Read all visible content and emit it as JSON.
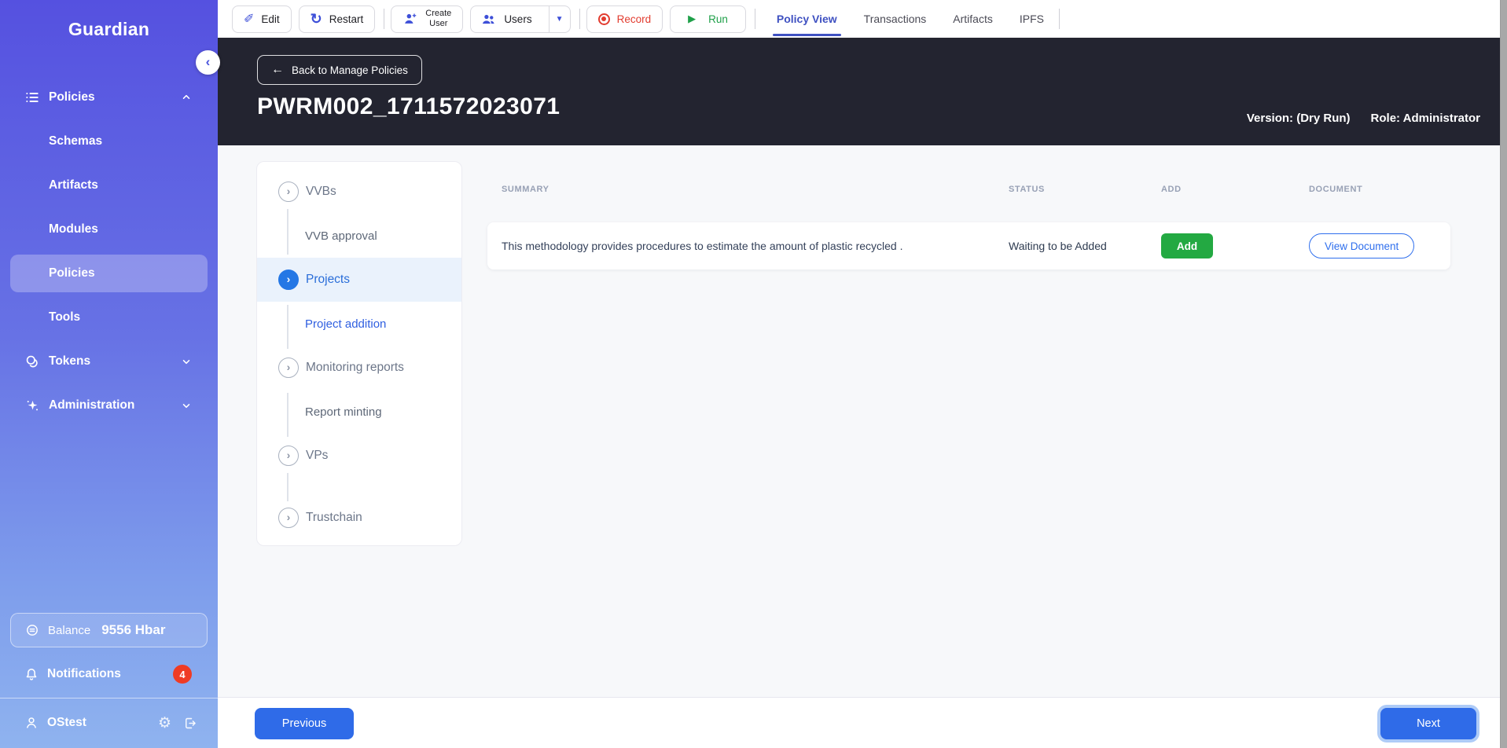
{
  "sidebar": {
    "logo": "Guardian",
    "policies": {
      "label": "Policies"
    },
    "policies_children": [
      {
        "label": "Schemas"
      },
      {
        "label": "Artifacts"
      },
      {
        "label": "Modules"
      },
      {
        "label": "Policies",
        "selected": true
      },
      {
        "label": "Tools"
      }
    ],
    "tokens": {
      "label": "Tokens"
    },
    "administration": {
      "label": "Administration"
    },
    "balance": {
      "label": "Balance",
      "value": "9556 Hbar"
    },
    "notifications": {
      "label": "Notifications",
      "count": "4"
    },
    "user": {
      "name": "OStest"
    }
  },
  "toolbar": {
    "edit_label": "Edit",
    "restart_label": "Restart",
    "create_user_line1": "Create",
    "create_user_line2": "User",
    "users_label": "Users",
    "record_label": "Record",
    "run_label": "Run",
    "tabs": [
      {
        "label": "Policy View",
        "active": true
      },
      {
        "label": "Transactions",
        "active": false
      },
      {
        "label": "Artifacts",
        "active": false
      },
      {
        "label": "IPFS",
        "active": false
      }
    ]
  },
  "header": {
    "back_label": "Back to Manage Policies",
    "title": "PWRM002_1711572023071",
    "version": "Version: (Dry Run)",
    "role": "Role: Administrator"
  },
  "stepper": {
    "items": [
      {
        "label": "VVBs",
        "type": "step",
        "state": "default"
      },
      {
        "label": "VVB approval",
        "type": "substep",
        "state": "default"
      },
      {
        "label": "Projects",
        "type": "step",
        "state": "active"
      },
      {
        "label": "Project addition",
        "type": "substep",
        "state": "active"
      },
      {
        "label": "Monitoring reports",
        "type": "step",
        "state": "default"
      },
      {
        "label": "Report minting",
        "type": "substep",
        "state": "default"
      },
      {
        "label": "VPs",
        "type": "step",
        "state": "default"
      },
      {
        "label": "Trustchain",
        "type": "step",
        "state": "default"
      }
    ]
  },
  "table": {
    "columns": [
      "SUMMARY",
      "STATUS",
      "ADD",
      "DOCUMENT"
    ],
    "rows": [
      {
        "summary": "This methodology provides procedures to estimate the amount of plastic recycled .",
        "status": "Waiting to be Added",
        "add_label": "Add",
        "document_label": "View Document"
      }
    ]
  },
  "footer": {
    "previous_label": "Previous",
    "next_label": "Next"
  },
  "colors": {
    "sidebar_top": "#5551e0",
    "sidebar_bottom": "#8fb3ef",
    "dark_header": "#232430",
    "accent_blue": "#2f6be8",
    "toolbar_icon_blue": "#3d4fd8",
    "active_tab_blue": "#3f51c1",
    "stepper_active_blue": "#2477e5",
    "stepper_active_bg": "#eaf2fc",
    "add_green": "#23a942",
    "record_red": "#e23c2f",
    "badge_red": "#ef3b24",
    "content_bg": "#f7f8fa"
  }
}
